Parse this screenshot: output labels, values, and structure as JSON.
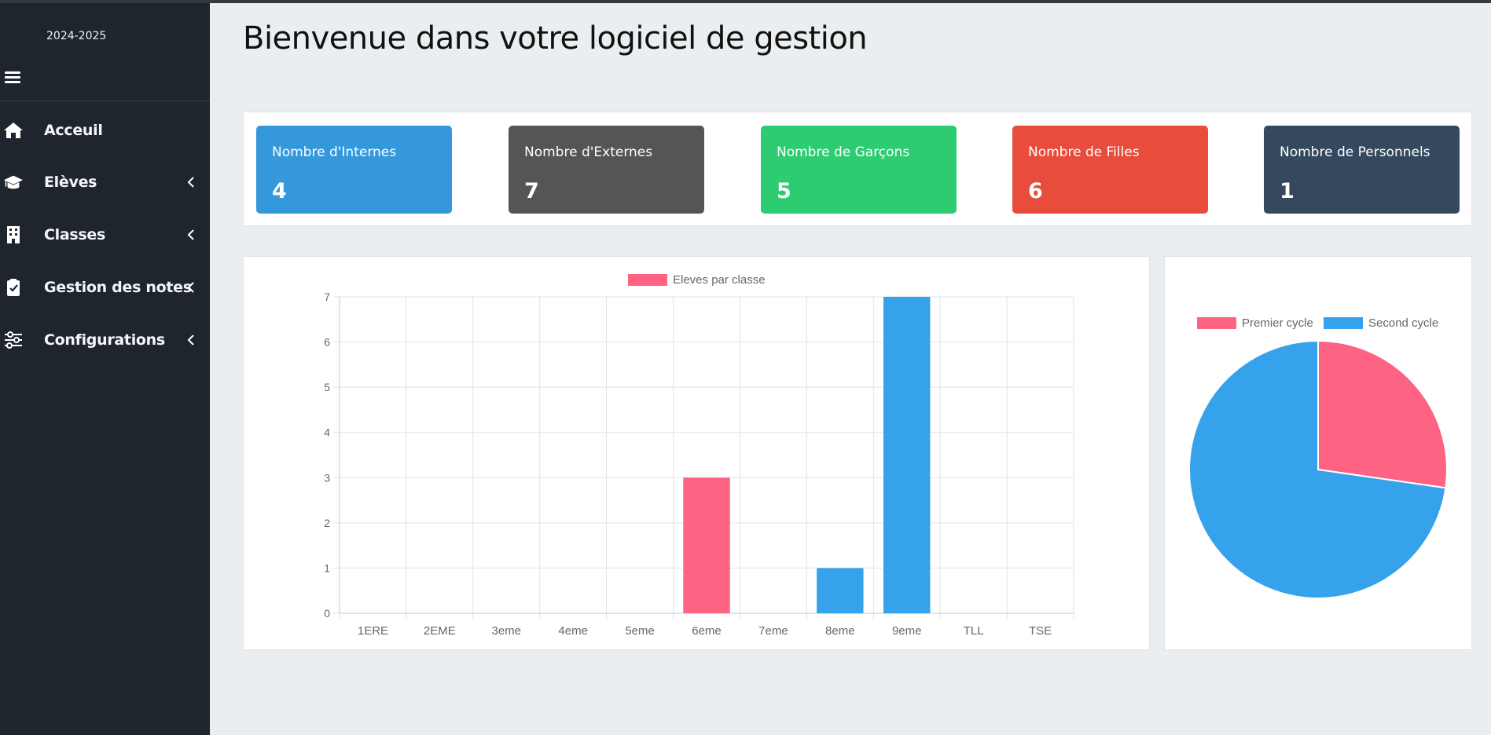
{
  "sidebar": {
    "year": "2024-2025",
    "menu_icon": "hamburger-icon",
    "items": [
      {
        "label": "Acceuil",
        "icon": "home-icon",
        "has_chevron": false
      },
      {
        "label": "Elèves",
        "icon": "graduation-cap-icon",
        "has_chevron": true
      },
      {
        "label": "Classes",
        "icon": "building-icon",
        "has_chevron": true
      },
      {
        "label": "Gestion des notes",
        "icon": "clipboard-check-icon",
        "has_chevron": true
      },
      {
        "label": "Configurations",
        "icon": "sliders-icon",
        "has_chevron": true
      }
    ]
  },
  "main": {
    "title": "Bienvenue dans votre logiciel de gestion"
  },
  "stats": [
    {
      "label": "Nombre d'Internes",
      "value": "4",
      "color": "#3498db"
    },
    {
      "label": "Nombre d'Externes",
      "value": "7",
      "color": "#555555"
    },
    {
      "label": "Nombre de Garçons",
      "value": "5",
      "color": "#2ecc71"
    },
    {
      "label": "Nombre de Filles",
      "value": "6",
      "color": "#e74c3c"
    },
    {
      "label": "Nombre de Personnels",
      "value": "1",
      "color": "#34495e"
    }
  ],
  "colors": {
    "pink": "#ff6384",
    "blue": "#36a2eb",
    "sidebar_bg": "#1f252c",
    "page_bg": "#ebeef0"
  },
  "chart_data": [
    {
      "type": "bar",
      "legend": [
        "Eleves par classe"
      ],
      "categories": [
        "1ERE",
        "2EME",
        "3eme",
        "4eme",
        "5eme",
        "6eme",
        "7eme",
        "8eme",
        "9eme",
        "TLL",
        "TSE"
      ],
      "values": [
        0,
        0,
        0,
        0,
        0,
        3,
        0,
        1,
        7,
        0,
        0
      ],
      "bar_colors": [
        "#ff6384",
        "#ff6384",
        "#ff6384",
        "#ff6384",
        "#ff6384",
        "#ff6384",
        "#36a2eb",
        "#36a2eb",
        "#36a2eb",
        "#36a2eb",
        "#36a2eb"
      ],
      "ylim": [
        0,
        7
      ],
      "yticks": [
        0,
        1,
        2,
        3,
        4,
        5,
        6,
        7
      ],
      "grid": true,
      "legend_position": "top"
    },
    {
      "type": "pie",
      "labels": [
        "Premier cycle",
        "Second cycle"
      ],
      "values": [
        3,
        8
      ],
      "colors": [
        "#ff6384",
        "#36a2eb"
      ],
      "legend_position": "top"
    }
  ]
}
